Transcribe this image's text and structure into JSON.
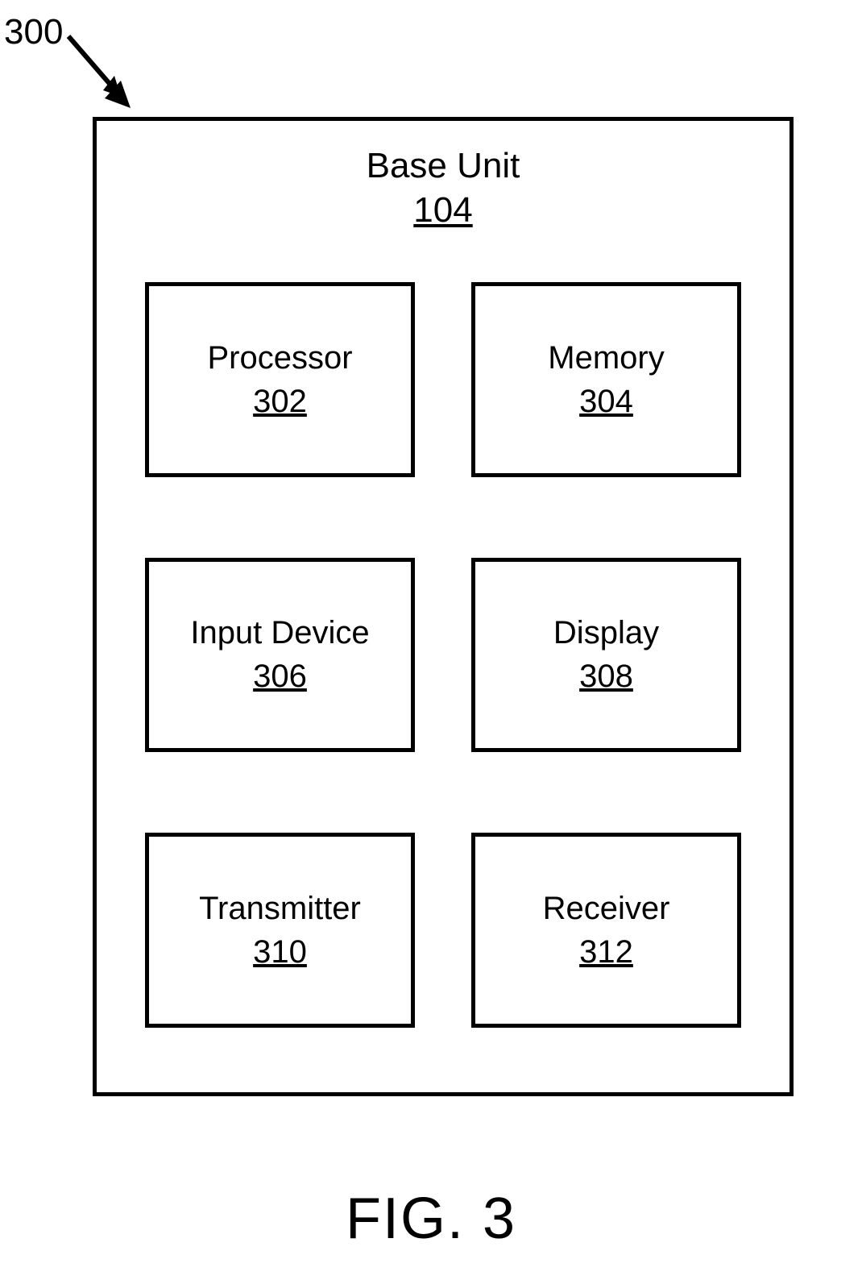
{
  "figure_ref": "300",
  "figure_label": "FIG. 3",
  "outer": {
    "title": "Base Unit",
    "ref": "104"
  },
  "components": [
    {
      "name": "Processor",
      "ref": "302"
    },
    {
      "name": "Memory",
      "ref": "304"
    },
    {
      "name": "Input Device",
      "ref": "306"
    },
    {
      "name": "Display",
      "ref": "308"
    },
    {
      "name": "Transmitter",
      "ref": "310"
    },
    {
      "name": "Receiver",
      "ref": "312"
    }
  ]
}
